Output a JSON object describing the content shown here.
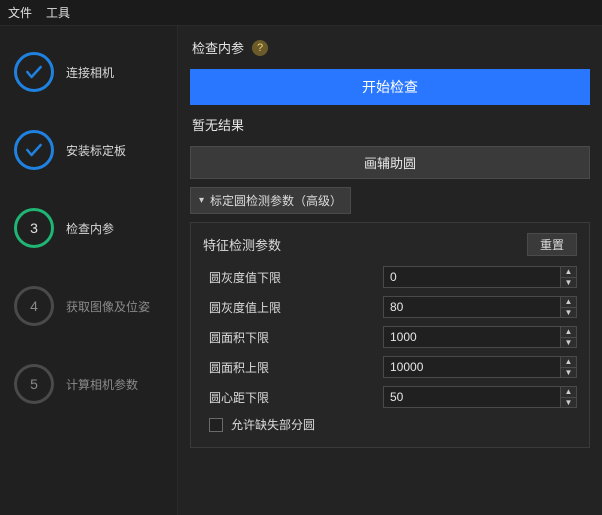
{
  "menubar": {
    "file": "文件",
    "tools": "工具"
  },
  "sidebar": {
    "steps": [
      {
        "index": "",
        "label": "连接相机",
        "state": "done"
      },
      {
        "index": "",
        "label": "安装标定板",
        "state": "done"
      },
      {
        "index": "3",
        "label": "检查内参",
        "state": "current"
      },
      {
        "index": "4",
        "label": "获取图像及位姿",
        "state": "pending"
      },
      {
        "index": "5",
        "label": "计算相机参数",
        "state": "pending"
      }
    ]
  },
  "main": {
    "title": "检查内参",
    "help_icon": "?",
    "start_btn": "开始检查",
    "status": "暂无结果",
    "draw_btn": "画辅助圆",
    "section_header": "标定圆检测参数（高级）",
    "chevron": "▾",
    "panel": {
      "title": "特征检测参数",
      "reset": "重置",
      "fields": [
        {
          "label": "圆灰度值下限",
          "value": "0"
        },
        {
          "label": "圆灰度值上限",
          "value": "80"
        },
        {
          "label": "圆面积下限",
          "value": "1000"
        },
        {
          "label": "圆面积上限",
          "value": "10000"
        },
        {
          "label": "圆心距下限",
          "value": "50"
        }
      ],
      "checkbox_label": "允许缺失部分圆",
      "checkbox_checked": false
    }
  }
}
